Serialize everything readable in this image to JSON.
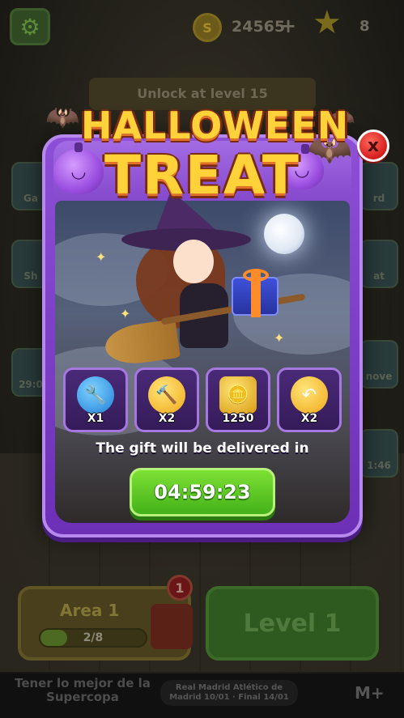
{
  "topbar": {
    "settings_icon": "gear-icon",
    "coin_symbol": "S",
    "coins": "24565",
    "coin_plus": "+",
    "stars": "8"
  },
  "background": {
    "unlock_banner": "Unlock at level 15",
    "side_left": [
      "Ga",
      "Sh",
      "29:0"
    ],
    "side_right": [
      "rd",
      "at",
      "nove",
      "1:46"
    ]
  },
  "popup": {
    "title_line1": "HALLOWEEN",
    "title_line2": "TREAT",
    "close_label": "x",
    "rewards": [
      {
        "icon": "drill-icon",
        "label": "X1",
        "color": "#2a9bf0"
      },
      {
        "icon": "hammer-wrench-icon",
        "label": "X2",
        "color": "#f2b41a"
      },
      {
        "icon": "coins-icon",
        "label": "1250",
        "color": "#f2c21a"
      },
      {
        "icon": "undo-icon",
        "label": "X2",
        "color": "#f2b41a"
      }
    ],
    "delivery_text": "The gift will be delivered in",
    "timer": "04:59:23"
  },
  "bottom": {
    "area_title": "Area 1",
    "area_progress_label": "2/8",
    "area_progress": 0.25,
    "area_badge": "1",
    "level_button": "Level 1"
  },
  "ad": {
    "left_text": "Tener lo mejor de la Supercopa",
    "mid_text": "Real Madrid Atlético de Madrid 10/01 · Final 14/01",
    "logo": "M+"
  }
}
